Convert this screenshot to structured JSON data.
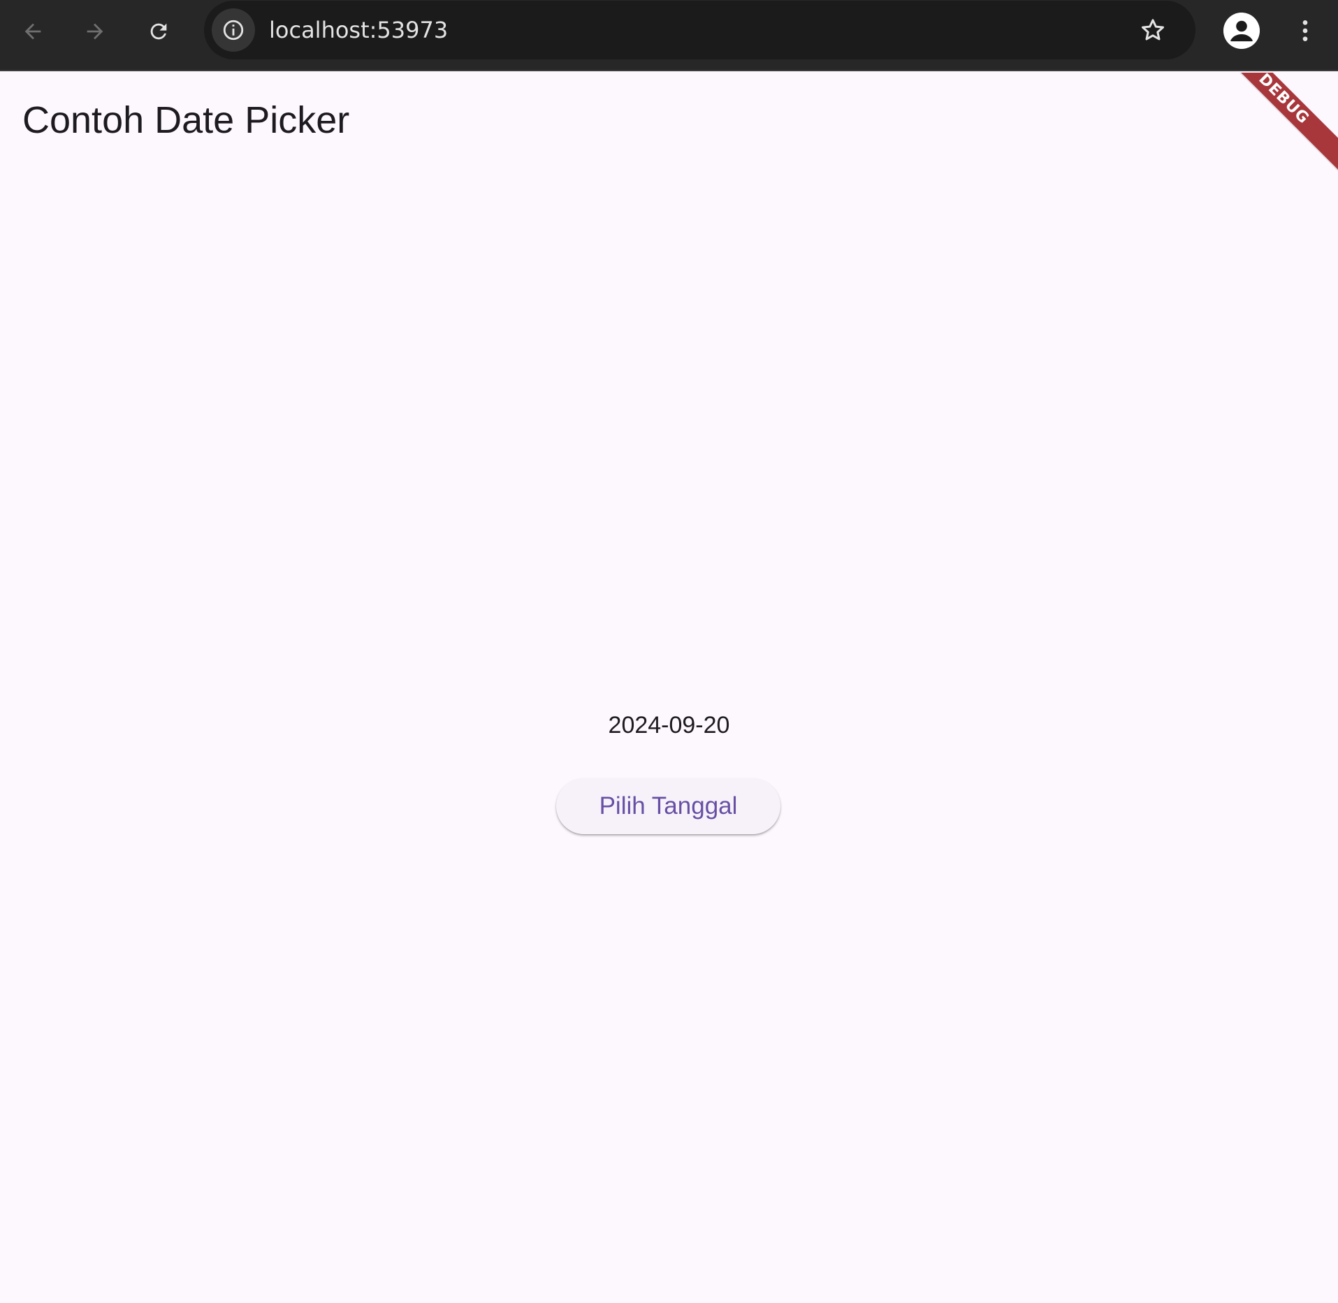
{
  "browser": {
    "url": "localhost:53973",
    "back_icon": "arrow-left-icon",
    "forward_icon": "arrow-right-icon",
    "reload_icon": "reload-icon",
    "info_icon": "info-icon",
    "bookmark_icon": "star-icon",
    "profile_icon": "person-icon",
    "menu_icon": "more-vertical-icon"
  },
  "app": {
    "title": "Contoh Date Picker",
    "selected_date": "2024-09-20",
    "pick_button_label": "Pilih Tanggal",
    "debug_banner": "DEBUG"
  },
  "colors": {
    "toolbar_bg": "#272727",
    "omnibox_bg": "#1b1b1b",
    "page_bg": "#fdf7fe",
    "button_bg": "#f7f2fa",
    "button_text": "#6750a4",
    "debug_banner": "#a8373c",
    "title_text": "#1d1b20"
  }
}
